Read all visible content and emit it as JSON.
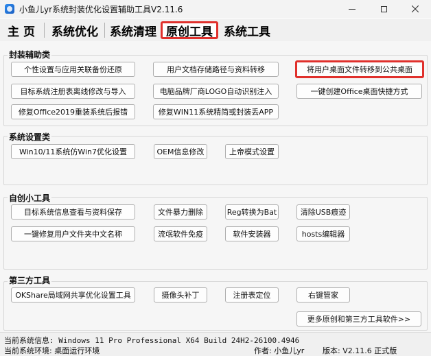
{
  "window": {
    "title": "小鱼儿yr系统封装优化设置辅助工具V2.11.6"
  },
  "tabs": [
    {
      "label": "主 页"
    },
    {
      "label": "系统优化"
    },
    {
      "label": "系统清理"
    },
    {
      "label": "原创工具"
    },
    {
      "label": "系统工具"
    }
  ],
  "groups": {
    "packaging": {
      "title": "封装辅助类",
      "buttons": [
        "个性设置与应用关联备份还原",
        "用户文档存储路径与资料转移",
        "将用户桌面文件转移到公共桌面",
        "目标系统注册表离线修改与导入",
        "电脑品牌厂商LOGO自动识别注入",
        "一键创建Office桌面快捷方式",
        "修复Office2019重装系统后报错",
        "修复WIN11系统精简或封装丢APP"
      ]
    },
    "settings": {
      "title": "系统设置类",
      "buttons": [
        "Win10/11系统仿Win7优化设置",
        "OEM信息修改",
        "上帝模式设置"
      ]
    },
    "original_tools": {
      "title": "自创小工具",
      "buttons": [
        "目标系统信息查看与资料保存",
        "文件暴力删除",
        "Reg转换为Bat",
        "清除USB痕迹",
        "一键修复用户文件夹中文名称",
        "流氓软件免疫",
        "软件安装器",
        "hosts编辑器"
      ]
    },
    "third_party": {
      "title": "第三方工具",
      "buttons": [
        "OKShare局域网共享优化设置工具",
        "摄像头补丁",
        "注册表定位",
        "右键管家"
      ]
    }
  },
  "more_button": "更多原创和第三方工具软件>>",
  "status": {
    "system_info": "当前系统信息: Windows 11 Pro Professional X64 Build 24H2-26100.4946",
    "env": "当前系统环境: 桌面运行环境",
    "author": "作者: 小鱼儿yr",
    "version": "版本: V2.11.6 正式版"
  },
  "colors": {
    "highlight": "#e0302c"
  }
}
